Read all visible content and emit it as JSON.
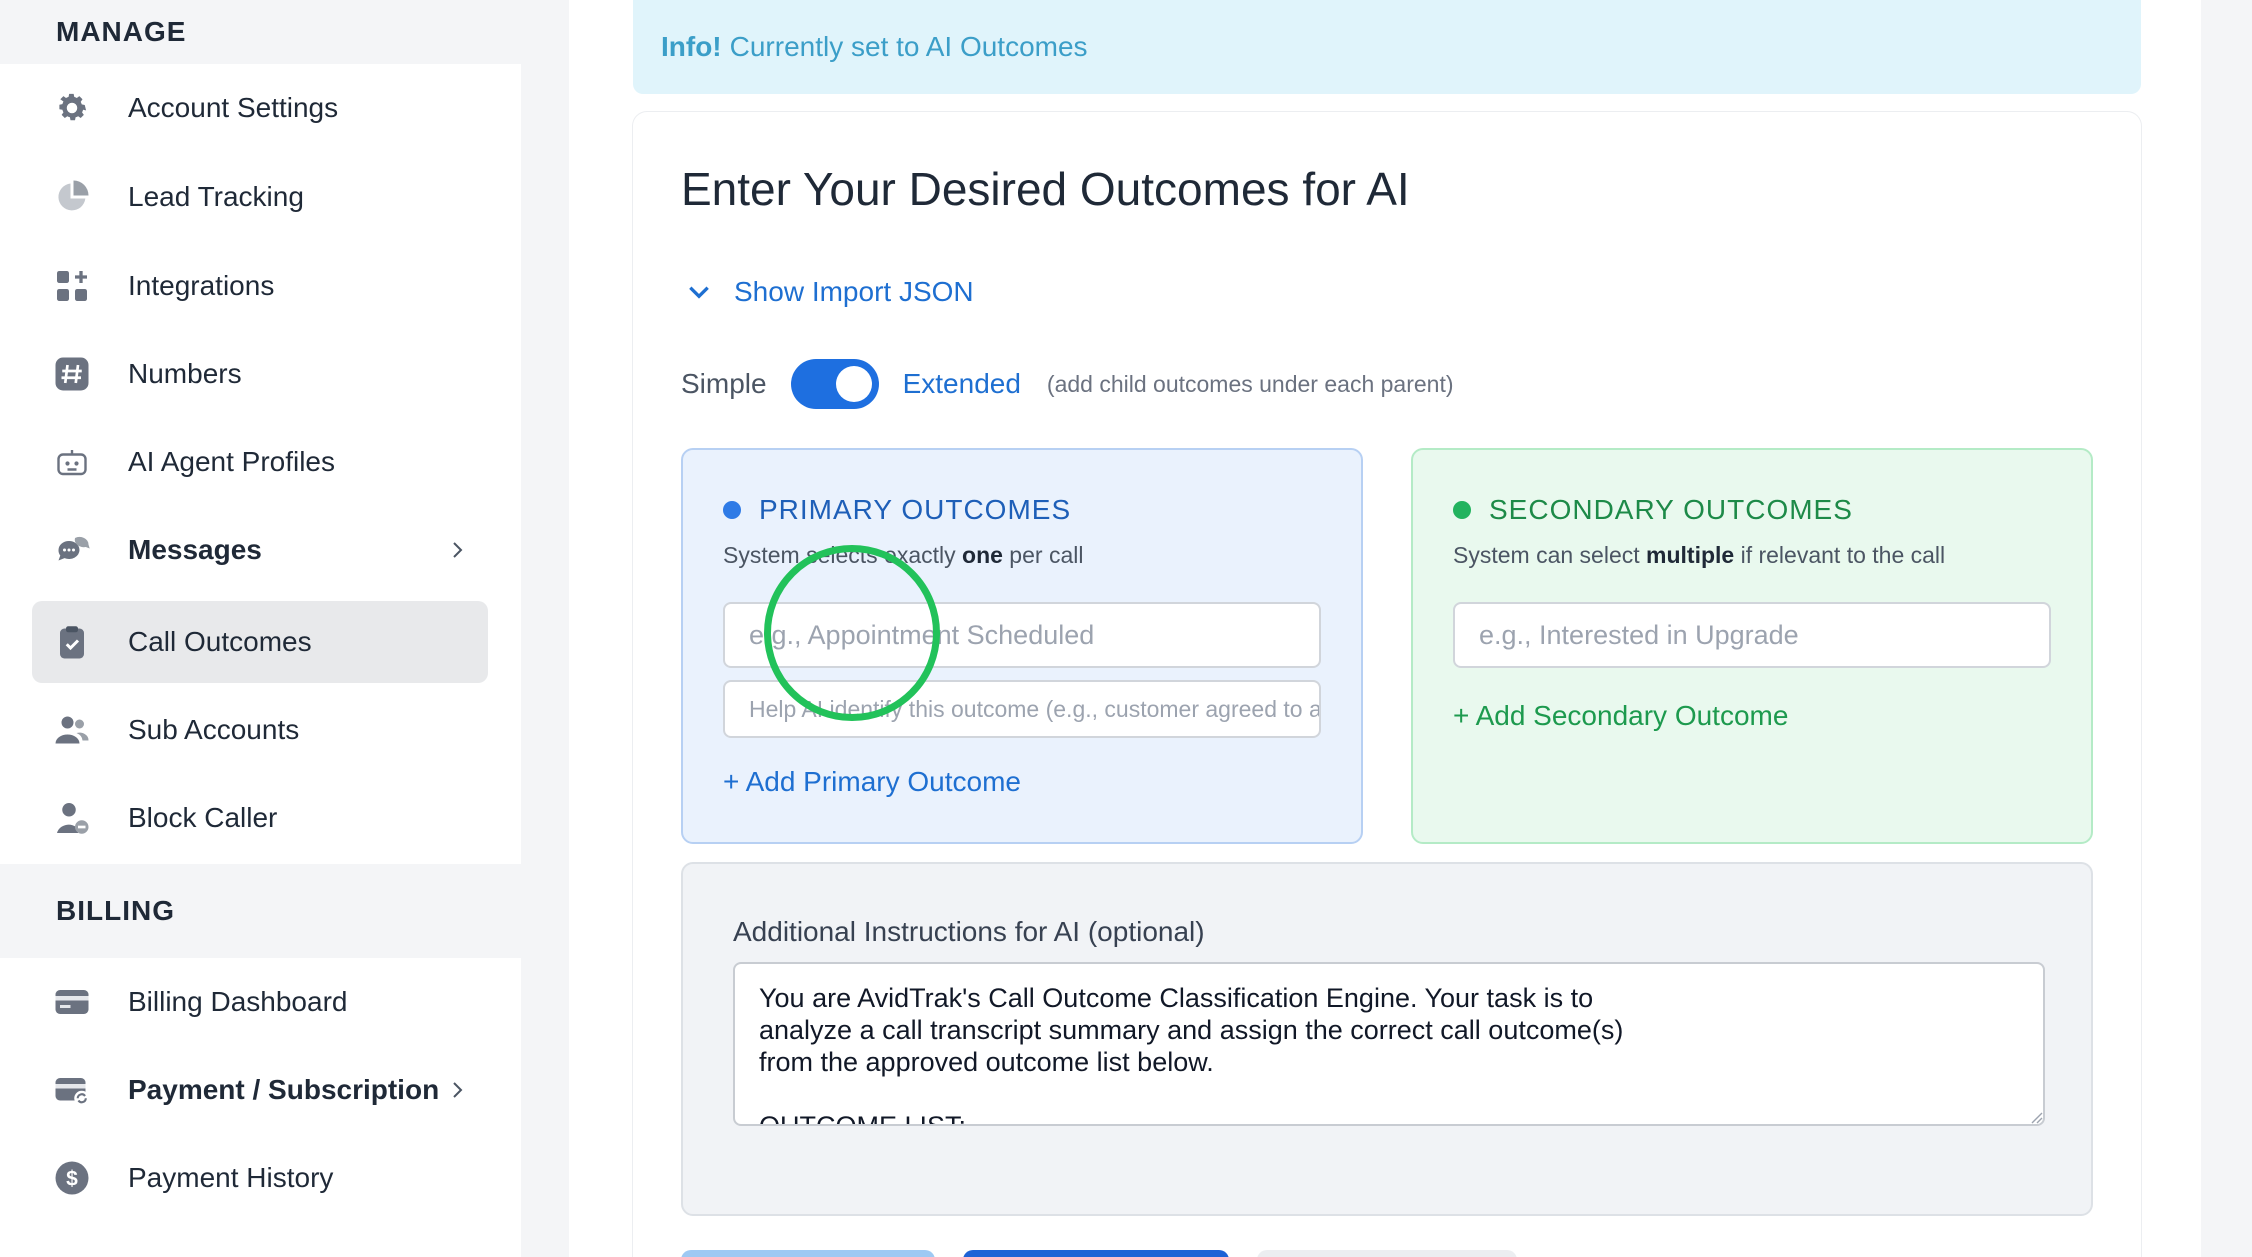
{
  "sidebar": {
    "manage_heading": "MANAGE",
    "billing_heading": "BILLING",
    "items": [
      {
        "label": "Account Settings",
        "icon": "gear-icon"
      },
      {
        "label": "Lead Tracking",
        "icon": "pie-chart-icon"
      },
      {
        "label": "Integrations",
        "icon": "grid-plus-icon"
      },
      {
        "label": "Numbers",
        "icon": "hash-icon"
      },
      {
        "label": "AI Agent Profiles",
        "icon": "robot-icon"
      },
      {
        "label": "Messages",
        "icon": "chat-bubbles-icon"
      },
      {
        "label": "Call Outcomes",
        "icon": "clipboard-check-icon"
      },
      {
        "label": "Sub Accounts",
        "icon": "users-icon"
      },
      {
        "label": "Block Caller",
        "icon": "user-block-icon"
      }
    ],
    "billing_items": [
      {
        "label": "Billing Dashboard",
        "icon": "credit-card-icon"
      },
      {
        "label": "Payment / Subscription",
        "icon": "card-refresh-icon"
      },
      {
        "label": "Payment History",
        "icon": "dollar-circle-icon"
      }
    ],
    "active_item": "Call Outcomes"
  },
  "info": {
    "strong": "Info!",
    "text": "Currently set to AI Outcomes"
  },
  "main": {
    "title": "Enter Your Desired Outcomes for AI",
    "import_toggle": "Show Import JSON",
    "mode": {
      "simple": "Simple",
      "extended": "Extended",
      "hint": "(add child outcomes under each parent)",
      "selected": "Extended"
    },
    "primary": {
      "title": "PRIMARY OUTCOMES",
      "sub_before": "System selects exactly ",
      "sub_bold": "one",
      "sub_after": " per call",
      "name_placeholder": "e.g., Appointment Scheduled",
      "help_placeholder": "Help AI identify this outcome (e.g., customer agreed to a time)",
      "add_label": "+ Add Primary Outcome"
    },
    "secondary": {
      "title": "SECONDARY OUTCOMES",
      "sub_before": "System can select ",
      "sub_bold": "multiple",
      "sub_after": " if relevant to the call",
      "name_placeholder": "e.g., Interested in Upgrade",
      "add_label": "+ Add Secondary Outcome"
    },
    "instructions": {
      "label": "Additional Instructions for AI (optional)",
      "value": "You are AvidTrak's Call Outcome Classification Engine. Your task is to\nanalyze a call transcript summary and assign the correct call outcome(s)\nfrom the approved outcome list below.\n\nOUTCOME LIST:"
    }
  },
  "colors": {
    "accent_blue": "#1e6fe0",
    "accent_green": "#22b35e",
    "info_bg": "#e0f4fb",
    "click_ring": "#22c25a"
  }
}
